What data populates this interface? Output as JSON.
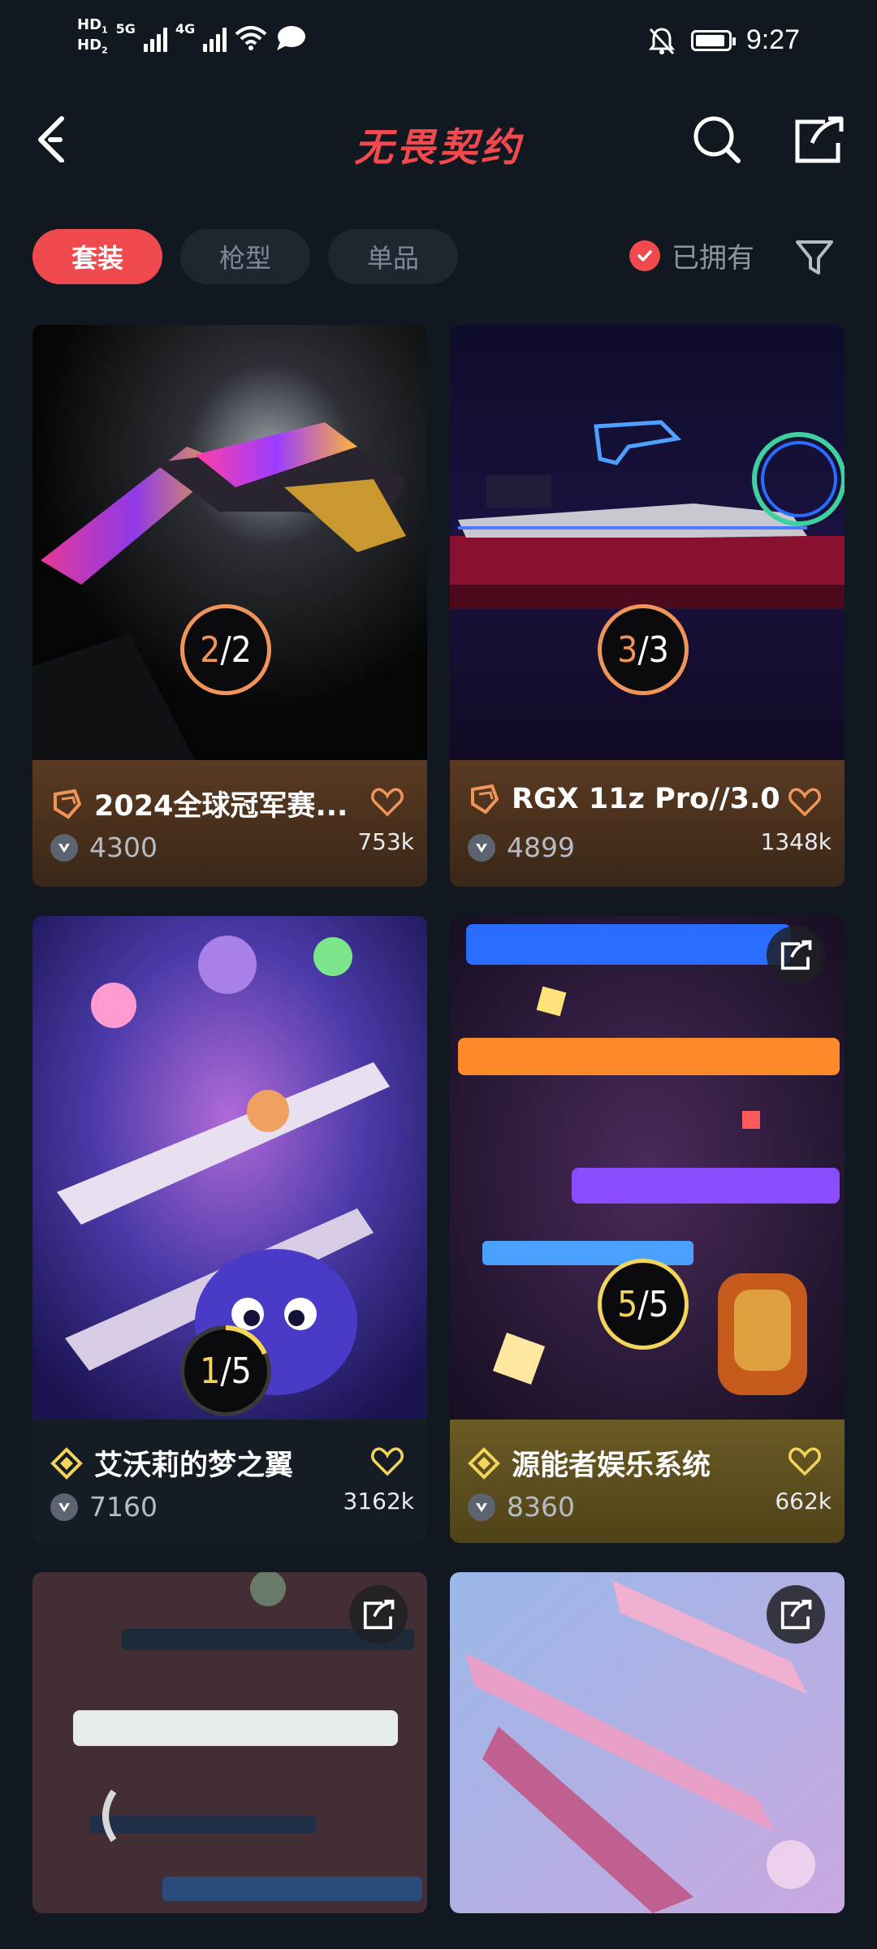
{
  "status_bar": {
    "hd1": "HD",
    "hd1_sub": "1",
    "hd2": "HD",
    "hd2_sub": "2",
    "net1": "5G",
    "net2": "4G",
    "time": "9:27"
  },
  "header": {
    "title": "无畏契约"
  },
  "tabs": [
    {
      "label": "套装",
      "active": true
    },
    {
      "label": "枪型",
      "active": false
    },
    {
      "label": "单品",
      "active": false
    }
  ],
  "filter": {
    "owned_label": "已拥有"
  },
  "cards": [
    {
      "title": "2024全球冠军赛...",
      "price": "4300",
      "likes": "753k",
      "progress": "2/2",
      "progress_owned": "2",
      "progress_total": "2",
      "tier_color": "#f0955a"
    },
    {
      "title": "RGX 11z Pro//3.0",
      "price": "4899",
      "likes": "1348k",
      "progress": "3/3",
      "progress_owned": "3",
      "progress_total": "3",
      "tier_color": "#f0955a"
    },
    {
      "title": "艾沃莉的梦之翼",
      "price": "7160",
      "likes": "3162k",
      "progress": "1/5",
      "progress_owned": "1",
      "progress_total": "5",
      "tier_color": "#f2d55a"
    },
    {
      "title": "源能者娱乐系统",
      "price": "8360",
      "likes": "662k",
      "progress": "5/5",
      "progress_owned": "5",
      "progress_total": "5",
      "tier_color": "#f2d55a"
    }
  ],
  "colors": {
    "accent": "#f04a4f",
    "background": "#111820",
    "premium_tier": "#f0955a",
    "exclusive_tier": "#f2d55a"
  }
}
